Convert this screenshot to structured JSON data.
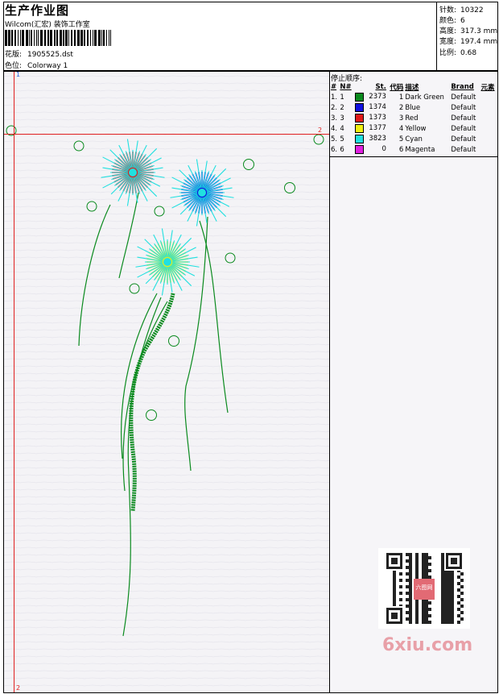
{
  "header": {
    "title": "生产作业图",
    "company": "Wilcom(汇宏) 装饰工作室",
    "design_label": "花版:",
    "design_value": "1905525.dst",
    "colorway_label": "色位:",
    "colorway_value": "Colorway 1"
  },
  "stats": [
    {
      "label": "针数:",
      "value": "10322"
    },
    {
      "label": "颜色:",
      "value": "6"
    },
    {
      "label": "高度:",
      "value": "317.3 mm"
    },
    {
      "label": "宽度:",
      "value": "197.4 mm"
    },
    {
      "label": "比例:",
      "value": "0.68"
    }
  ],
  "stop_sequence": {
    "title": "停止顺序:",
    "columns": [
      "#",
      "N#",
      "St.",
      "代码",
      "描述",
      "Brand",
      "元素"
    ],
    "rows": [
      {
        "idx": "1.",
        "n": "1",
        "color": "#0a8a1e",
        "st": "2373",
        "code": "1",
        "desc": "Dark Green",
        "brand": "Default"
      },
      {
        "idx": "2.",
        "n": "2",
        "color": "#1010e0",
        "st": "1374",
        "code": "2",
        "desc": "Blue",
        "brand": "Default"
      },
      {
        "idx": "3.",
        "n": "3",
        "color": "#e01818",
        "st": "1373",
        "code": "3",
        "desc": "Red",
        "brand": "Default"
      },
      {
        "idx": "4.",
        "n": "4",
        "color": "#f0f010",
        "st": "1377",
        "code": "4",
        "desc": "Yellow",
        "brand": "Default"
      },
      {
        "idx": "5.",
        "n": "5",
        "color": "#20e0e0",
        "st": "3823",
        "code": "5",
        "desc": "Cyan",
        "brand": "Default"
      },
      {
        "idx": "6.",
        "n": "6",
        "color": "#e020e0",
        "st": "0",
        "code": "6",
        "desc": "Magenta",
        "brand": "Default"
      }
    ]
  },
  "axes": {
    "top_label": "1",
    "right_label": "2",
    "bottom_label": "2"
  },
  "watermark": "6xiu.com",
  "qr_stamp": "六图网"
}
